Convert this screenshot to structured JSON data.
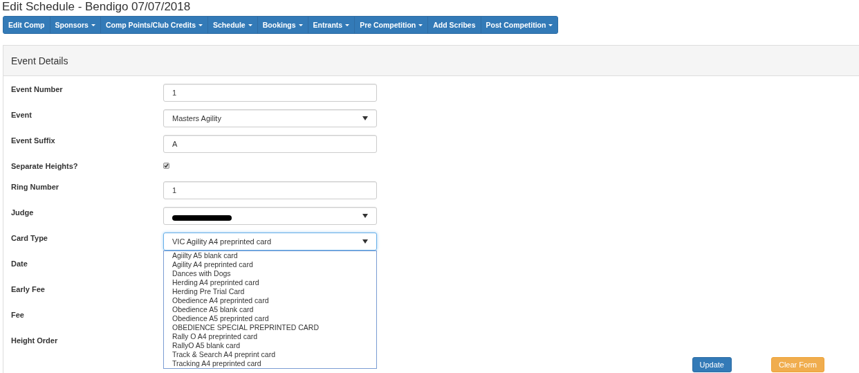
{
  "title": "Edit Schedule - Bendigo 07/07/2018",
  "nav": [
    {
      "label": "Edit Comp",
      "dropdown": false
    },
    {
      "label": "Sponsors",
      "dropdown": true
    },
    {
      "label": "Comp Points/Club Credits",
      "dropdown": true
    },
    {
      "label": "Schedule",
      "dropdown": true
    },
    {
      "label": "Bookings",
      "dropdown": true
    },
    {
      "label": "Entrants",
      "dropdown": true
    },
    {
      "label": "Pre Competition",
      "dropdown": true
    },
    {
      "label": "Add Scribes",
      "dropdown": false
    },
    {
      "label": "Post Competition",
      "dropdown": true
    }
  ],
  "panel": {
    "title": "Event Details"
  },
  "fields": [
    {
      "label": "Event Number",
      "kind": "text",
      "value": "1"
    },
    {
      "label": "Event",
      "kind": "select",
      "value": "Masters Agility"
    },
    {
      "label": "Event Suffix",
      "kind": "text",
      "value": "A"
    },
    {
      "label": "Separate Heights?",
      "kind": "checkbox",
      "checked": true
    },
    {
      "label": "Ring Number",
      "kind": "text",
      "value": "1"
    },
    {
      "label": "Judge",
      "kind": "redacted"
    },
    {
      "label": "Card Type",
      "kind": "select",
      "value": "VIC Agility A4 preprinted card",
      "open": true,
      "options": [
        "Agiilty A5 blank card",
        "Agility A4 preprinted card",
        "Dances with Dogs",
        "Herding A4 preprinted card",
        "Herding Pre Trial Card",
        "Obedience A4 preprinted card",
        "Obedience A5 blank card",
        "Obedience A5 preprinted card",
        "OBEDIENCE SPECIAL PREPRINTED CARD",
        "Rally O A4 preprinted card",
        "RallyO A5 blank card",
        "Track & Search A4 preprint card",
        "Tracking A4 preprinted card"
      ]
    },
    {
      "label": "Date",
      "kind": "hidden"
    },
    {
      "label": "Early Fee",
      "kind": "hidden"
    },
    {
      "label": "Fee",
      "kind": "hidden"
    },
    {
      "label": "Height Order",
      "kind": "hidden"
    }
  ],
  "buttons": [
    {
      "label": "Update",
      "kind": "primary"
    },
    {
      "label": "Clear Form",
      "kind": "warning"
    }
  ]
}
